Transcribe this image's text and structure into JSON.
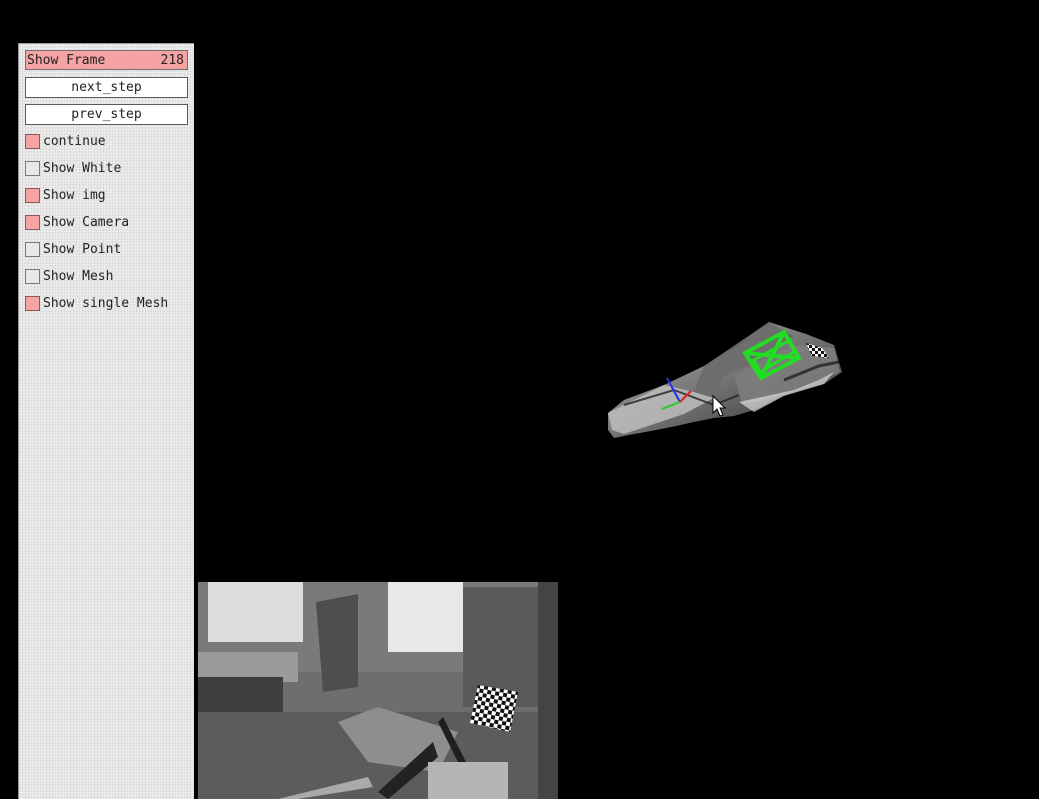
{
  "panel": {
    "show_frame": {
      "label": "Show Frame",
      "value": "218"
    },
    "buttons": [
      {
        "label": "next_step"
      },
      {
        "label": "prev_step"
      }
    ],
    "checkboxes": [
      {
        "label": "continue",
        "checked": true
      },
      {
        "label": "Show White",
        "checked": false
      },
      {
        "label": "Show img",
        "checked": true
      },
      {
        "label": "Show Camera",
        "checked": true
      },
      {
        "label": "Show Point",
        "checked": false
      },
      {
        "label": "Show Mesh",
        "checked": false
      },
      {
        "label": "Show single Mesh",
        "checked": true
      }
    ]
  },
  "colors": {
    "active": "#f5a3a3",
    "panel_bg": "#e6e6e6",
    "viewport_bg": "#000000",
    "camera_frustum": "#22dd22",
    "axis_x": "#dd2222",
    "axis_y": "#22cc22",
    "axis_z": "#2233ee"
  },
  "icons": {
    "cursor": "mouse-pointer-icon",
    "camera": "camera-frustum-icon",
    "axes": "coordinate-axes-icon",
    "checkerboard": "checkerboard-target-icon"
  }
}
